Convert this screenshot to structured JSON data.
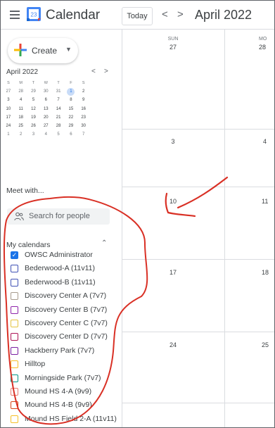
{
  "header": {
    "app_title": "Calendar",
    "logo_day": "23",
    "today_label": "Today",
    "prev_icon": "<",
    "next_icon": ">",
    "month_title": "April 2022"
  },
  "sidebar": {
    "create_label": "Create",
    "mini_calendar": {
      "title": "April 2022",
      "weekdays": [
        "S",
        "M",
        "T",
        "W",
        "T",
        "F",
        "S"
      ],
      "weeks": [
        [
          "27",
          "28",
          "29",
          "30",
          "31",
          "1",
          "2"
        ],
        [
          "3",
          "4",
          "5",
          "6",
          "7",
          "8",
          "9"
        ],
        [
          "10",
          "11",
          "12",
          "13",
          "14",
          "15",
          "16"
        ],
        [
          "17",
          "18",
          "19",
          "20",
          "21",
          "22",
          "23"
        ],
        [
          "24",
          "25",
          "26",
          "27",
          "28",
          "29",
          "30"
        ],
        [
          "1",
          "2",
          "3",
          "4",
          "5",
          "6",
          "7"
        ]
      ],
      "highlighted": "1"
    },
    "meet_title": "Meet with...",
    "people_placeholder": "Search for people",
    "my_calendars_title": "My calendars",
    "calendars": [
      {
        "label": "OWSC Administrator",
        "color": "#1a73e8",
        "checked": true
      },
      {
        "label": "Bederwood-A (11v11)",
        "color": "#3f51b5",
        "checked": false
      },
      {
        "label": "Bederwood-B (11v11)",
        "color": "#3f51b5",
        "checked": false
      },
      {
        "label": "Discovery Center A (7v7)",
        "color": "#a79b8e",
        "checked": false
      },
      {
        "label": "Discovery Center B (7v7)",
        "color": "#8e24aa",
        "checked": false
      },
      {
        "label": "Discovery Center C (7v7)",
        "color": "#e4c441",
        "checked": false
      },
      {
        "label": "Discovery Center D (7v7)",
        "color": "#ad1457",
        "checked": false
      },
      {
        "label": "Hackberry Park (7v7)",
        "color": "#7b1fa2",
        "checked": false
      },
      {
        "label": "Hilltop",
        "color": "#f6bf26",
        "checked": false
      },
      {
        "label": "Morningside Park (7v7)",
        "color": "#009688",
        "checked": false
      },
      {
        "label": "Mound HS 4-A (9v9)",
        "color": "#e67c73",
        "checked": false
      },
      {
        "label": "Mound HS 4-B (9v9)",
        "color": "#d84315",
        "checked": false
      },
      {
        "label": "Mound HS Field 2-A (11v11)",
        "color": "#f6bf26",
        "checked": false
      }
    ]
  },
  "grid": {
    "col1_header": "SUN",
    "col1_first_date": "27",
    "col2_header": "MO",
    "col2_first_date": "28",
    "col1_dates": [
      "3",
      "10",
      "17",
      "24"
    ],
    "col2_dates": [
      "4",
      "11",
      "18",
      "25"
    ]
  },
  "colors": {
    "accent": "#1a73e8",
    "annotation": "#d93025"
  }
}
